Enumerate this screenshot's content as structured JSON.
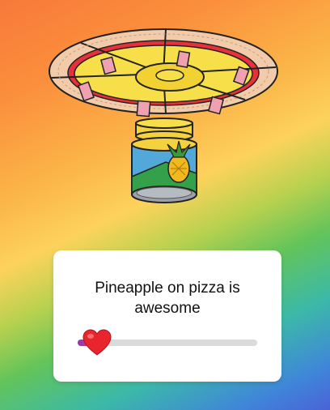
{
  "poll": {
    "question": "Pineapple on pizza is awesome",
    "slider_value": 0.08,
    "thumb_emoji": "heart-eyes-heart"
  },
  "colors": {
    "card_background": "#ffffff",
    "track": "#dbdbdb",
    "fill_start": "#8a3ab9",
    "fill_end": "#e1306c",
    "heart": "#e8252f"
  },
  "illustration": {
    "subject": "pizza with pineapple slices above a pineapple can",
    "icon": "pizza-pineapple-illustration"
  }
}
